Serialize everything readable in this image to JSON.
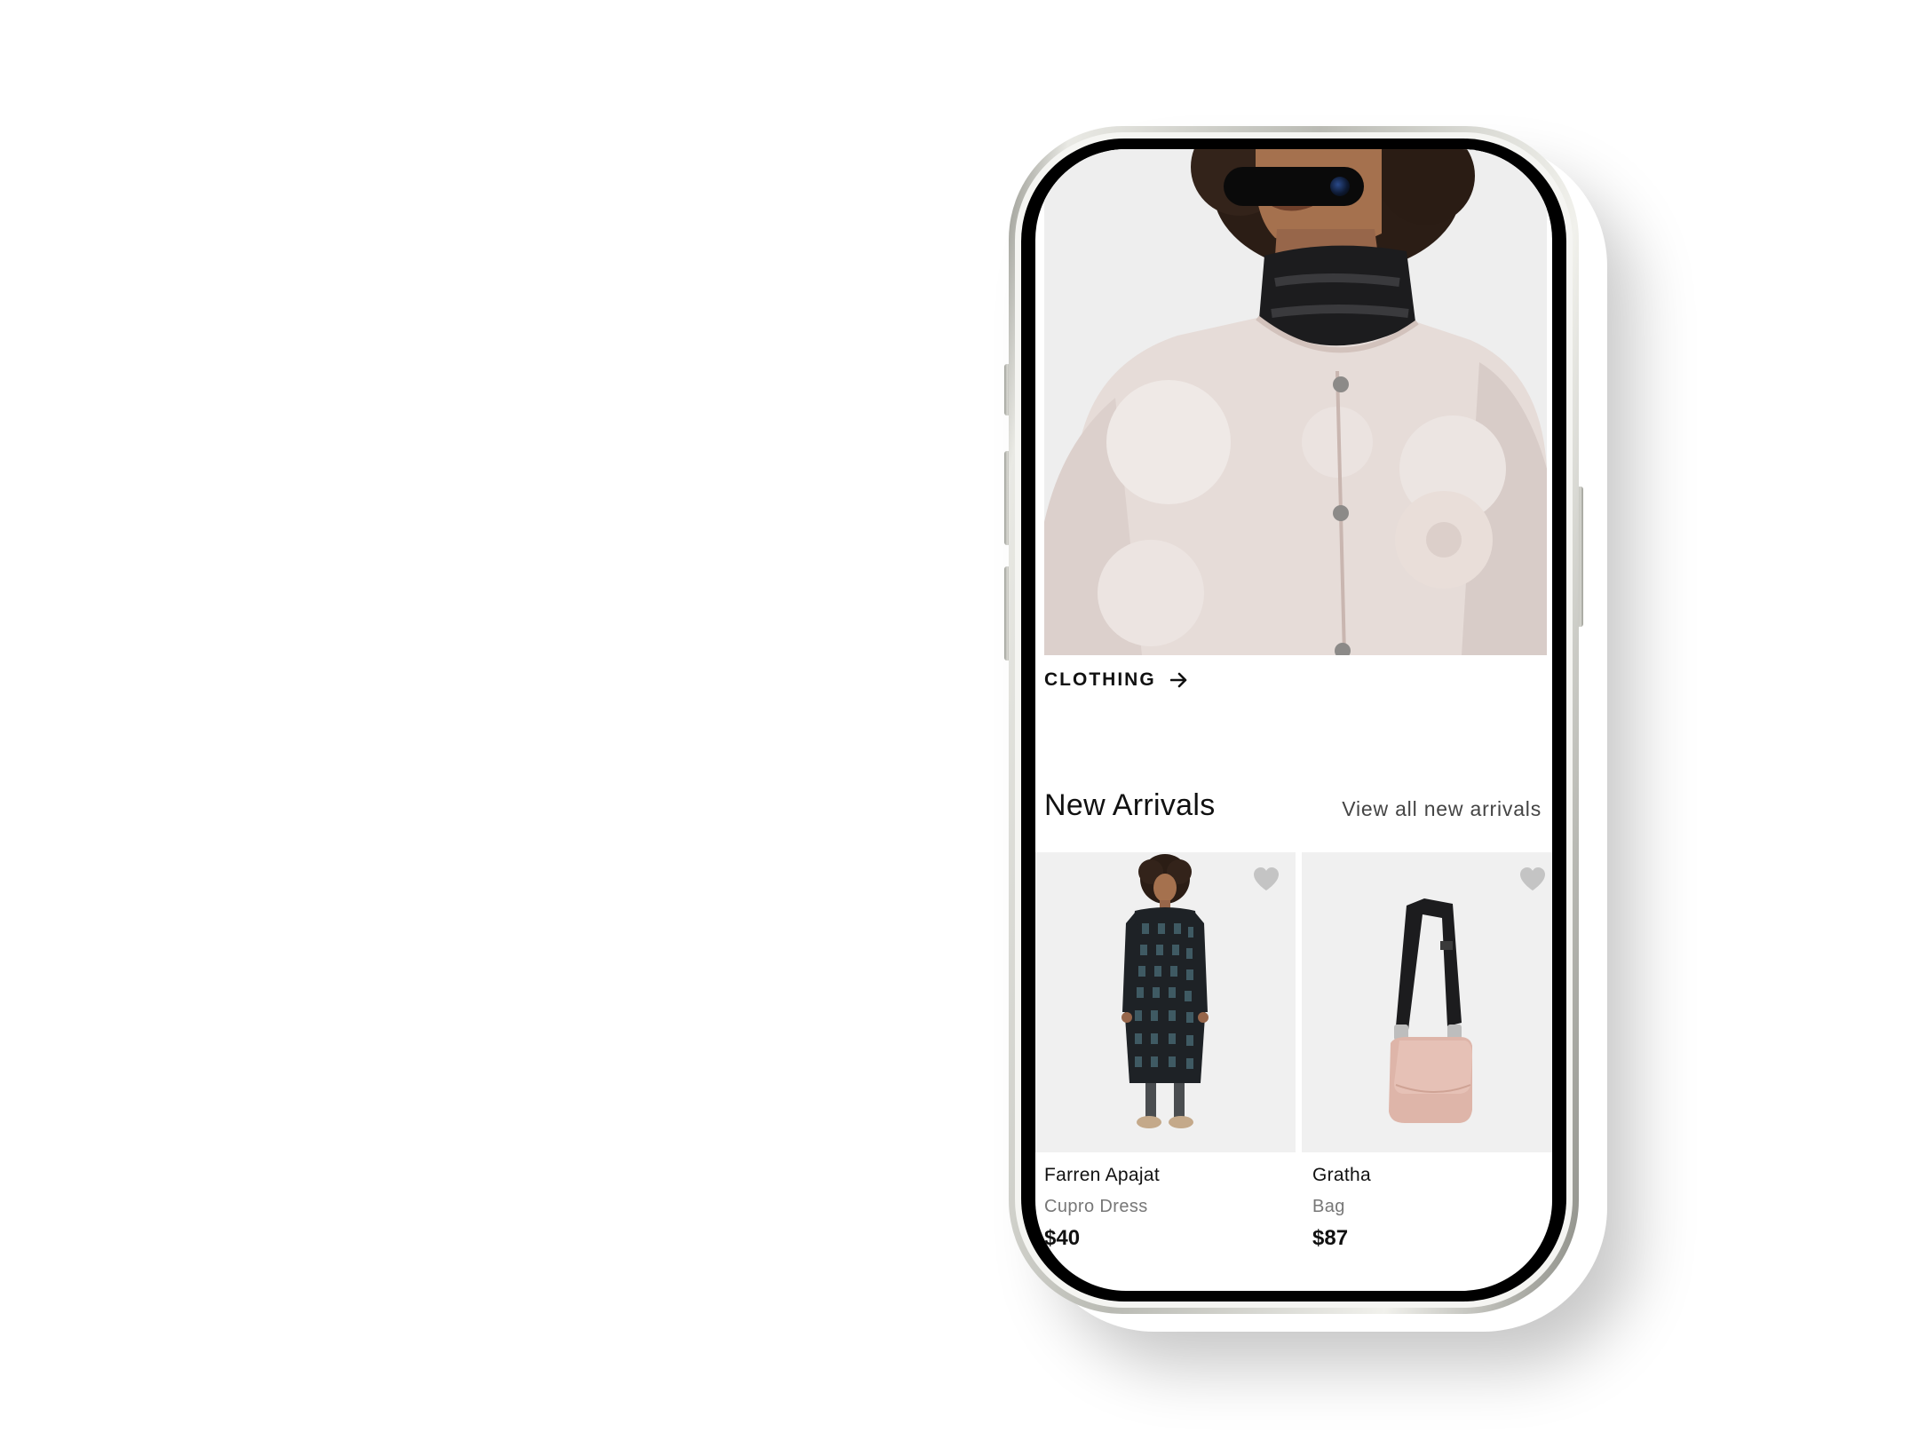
{
  "colors": {
    "text_primary": "#111111",
    "text_secondary": "#777777",
    "link": "#444444",
    "image_background": "#f0f0f0",
    "heart_inactive": "#c4c4c4",
    "phone_frame": "#c9c9c3"
  },
  "hero": {
    "category_label": "CLOTHING",
    "category_icon": "arrow-right-icon"
  },
  "new_arrivals": {
    "title": "New Arrivals",
    "view_all_label": "View all new arrivals",
    "products": [
      {
        "name": "Farren Apajat",
        "type": "Cupro Dress",
        "price": "$40",
        "favorite_icon": "heart-icon"
      },
      {
        "name": "Gratha",
        "type": "Bag",
        "price": "$87",
        "favorite_icon": "heart-icon"
      }
    ]
  }
}
